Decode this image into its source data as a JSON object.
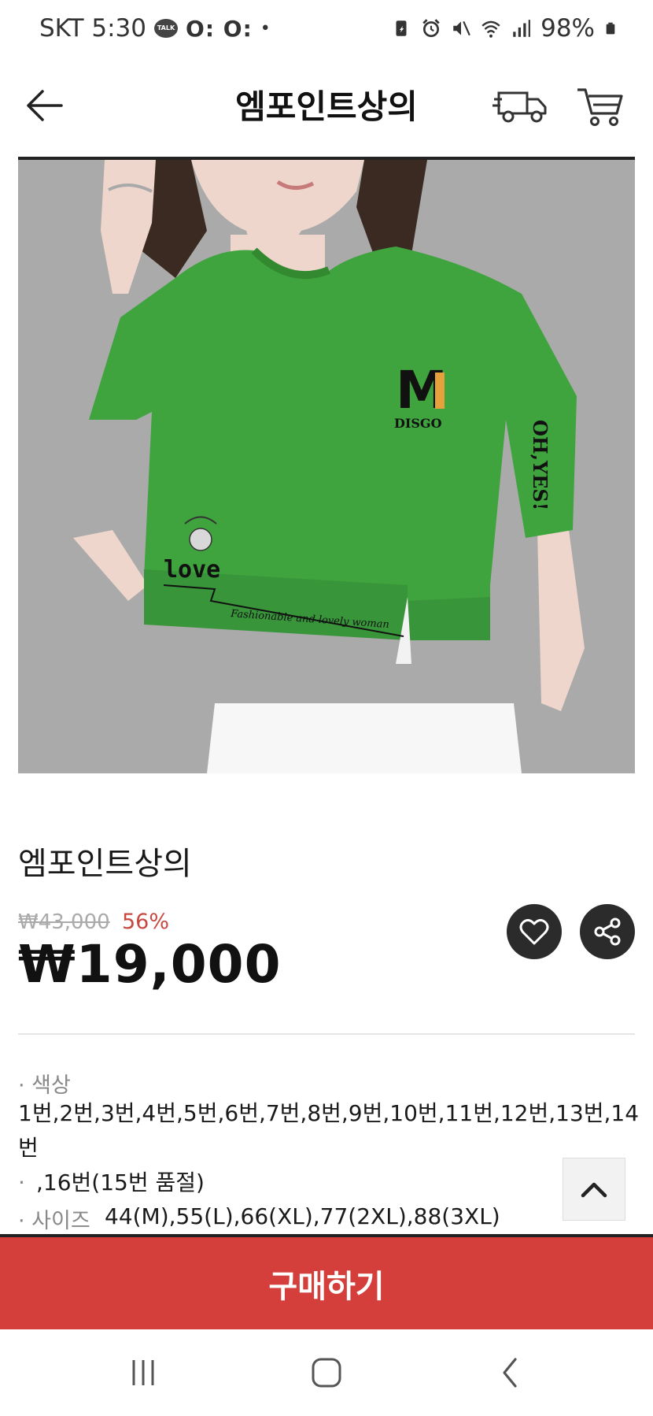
{
  "status_bar": {
    "carrier_time": "SKT 5:30",
    "talk_badge": "TALK",
    "notif_dots": "O: O:",
    "bullet": "•",
    "battery": "98%"
  },
  "header": {
    "title": "엠포인트상의",
    "icons": [
      "back-arrow-icon",
      "delivery-truck-icon",
      "shopping-cart-icon"
    ]
  },
  "product_image": {
    "shirt_color": "#3fa33e",
    "background": "#a9aaa9",
    "print_logo": "M",
    "print_brand": "DISGO",
    "print_sleeve": "OH,YES!",
    "print_love": "love",
    "print_slogan": "Fashionable and lovely woman"
  },
  "product": {
    "name": "엠포인트상의",
    "original_price": "₩43,000",
    "discount": "56%",
    "price": "₩19,000"
  },
  "options": {
    "color_label": "· 색상",
    "color_values_line1": "1번,2번,3번,4번,5번,6번,7번,8번,9번,10번,11번,12번,13번,14",
    "color_values_line2": "번",
    "color_values_line3_prefix": "·",
    "color_values_line3": ",16번(15번 품절)",
    "size_label": "· 사이즈",
    "size_values": "44(M),55(L),66(XL),77(2XL),88(3XL)"
  },
  "buy_button": {
    "label": "구매하기"
  },
  "colors": {
    "accent": "#d43f3b",
    "discount": "#c8473f",
    "dark_button": "#2b2b2b"
  }
}
